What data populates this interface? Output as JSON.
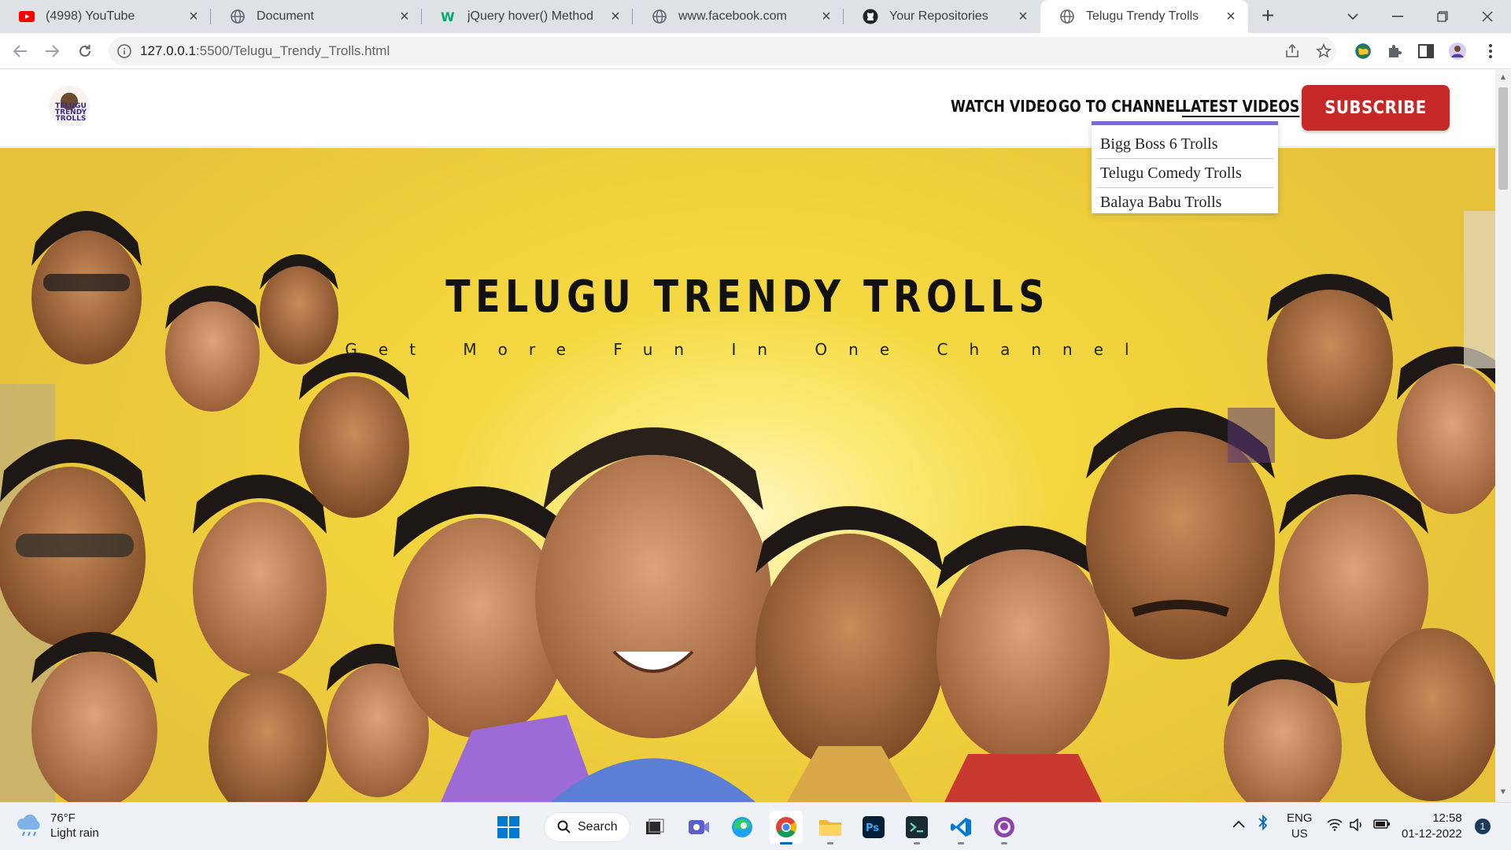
{
  "browser": {
    "tabs": [
      {
        "title": "(4998) YouTube",
        "icon": "youtube-icon"
      },
      {
        "title": "Document",
        "icon": "globe-icon"
      },
      {
        "title": "jQuery hover() Method",
        "icon": "w3schools-icon"
      },
      {
        "title": "www.facebook.com",
        "icon": "globe-icon"
      },
      {
        "title": "Your Repositories",
        "icon": "github-icon"
      },
      {
        "title": "Telugu Trendy Trolls",
        "icon": "globe-icon",
        "active": true
      }
    ],
    "url_host": "127.0.0.1",
    "url_path": ":5500/Telugu_Trendy_Trolls.html"
  },
  "site": {
    "logo_text": "TELUGU TRENDY TROLLS",
    "nav": {
      "watch_video": "WATCH VIDEO",
      "go_to_channel": "GO TO CHANNEL",
      "latest_videos": "LATEST VIDEOS"
    },
    "subscribe_label": "SUBSCRIBE",
    "dropdown_items": [
      "Bigg Boss 6 Trolls",
      "Telugu Comedy Trolls",
      "Balaya Babu Trolls"
    ],
    "hero_title": "TELUGU TRENDY TROLLS",
    "hero_subtitle": "Get More Fun In One Channel",
    "colors": {
      "subscribe": "#c62828",
      "dropdown_accent": "#7b6ad6",
      "hero_bg": "#f1d23c"
    }
  },
  "taskbar": {
    "weather_temp": "76°F",
    "weather_desc": "Light rain",
    "search_label": "Search",
    "lang_1": "ENG",
    "lang_2": "US",
    "time": "12:58",
    "date": "01-12-2022",
    "notification_count": "1"
  }
}
